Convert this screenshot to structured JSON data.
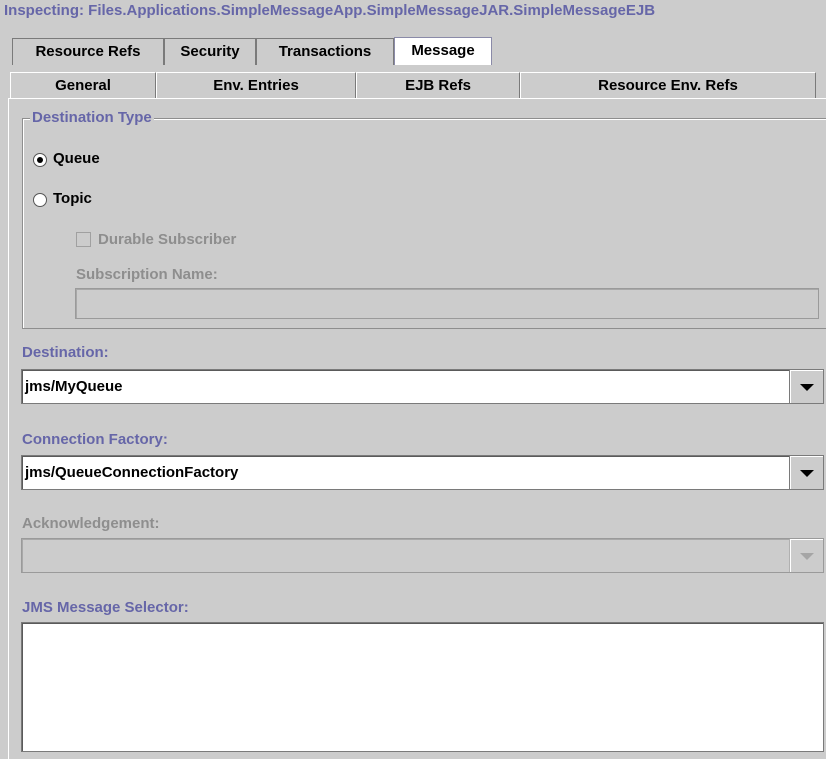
{
  "title": "Inspecting: Files.Applications.SimpleMessageApp.SimpleMessageJAR.SimpleMessageEJB",
  "tabs_row1": [
    "Resource Refs",
    "Security",
    "Transactions",
    "Message"
  ],
  "tabs_row2": [
    "General",
    "Env. Entries",
    "EJB Refs",
    "Resource Env. Refs"
  ],
  "selected_tab": "Message",
  "destination_type": {
    "legend": "Destination Type",
    "queue_label": "Queue",
    "topic_label": "Topic",
    "selected": "Queue",
    "durable_label": "Durable Subscriber",
    "subscription_label": "Subscription Name:",
    "subscription_value": ""
  },
  "destination": {
    "label": "Destination:",
    "value": "jms/MyQueue"
  },
  "connection_factory": {
    "label": "Connection Factory:",
    "value": "jms/QueueConnectionFactory"
  },
  "acknowledgement": {
    "label": "Acknowledgement:",
    "value": ""
  },
  "selector": {
    "label": "JMS Message Selector:",
    "value": ""
  },
  "colors": {
    "label_purple": "#6666a8",
    "background": "#cccccc",
    "disabled_text": "#8e8e8e"
  },
  "icons": {
    "dropdown": "chevron-down-icon"
  }
}
